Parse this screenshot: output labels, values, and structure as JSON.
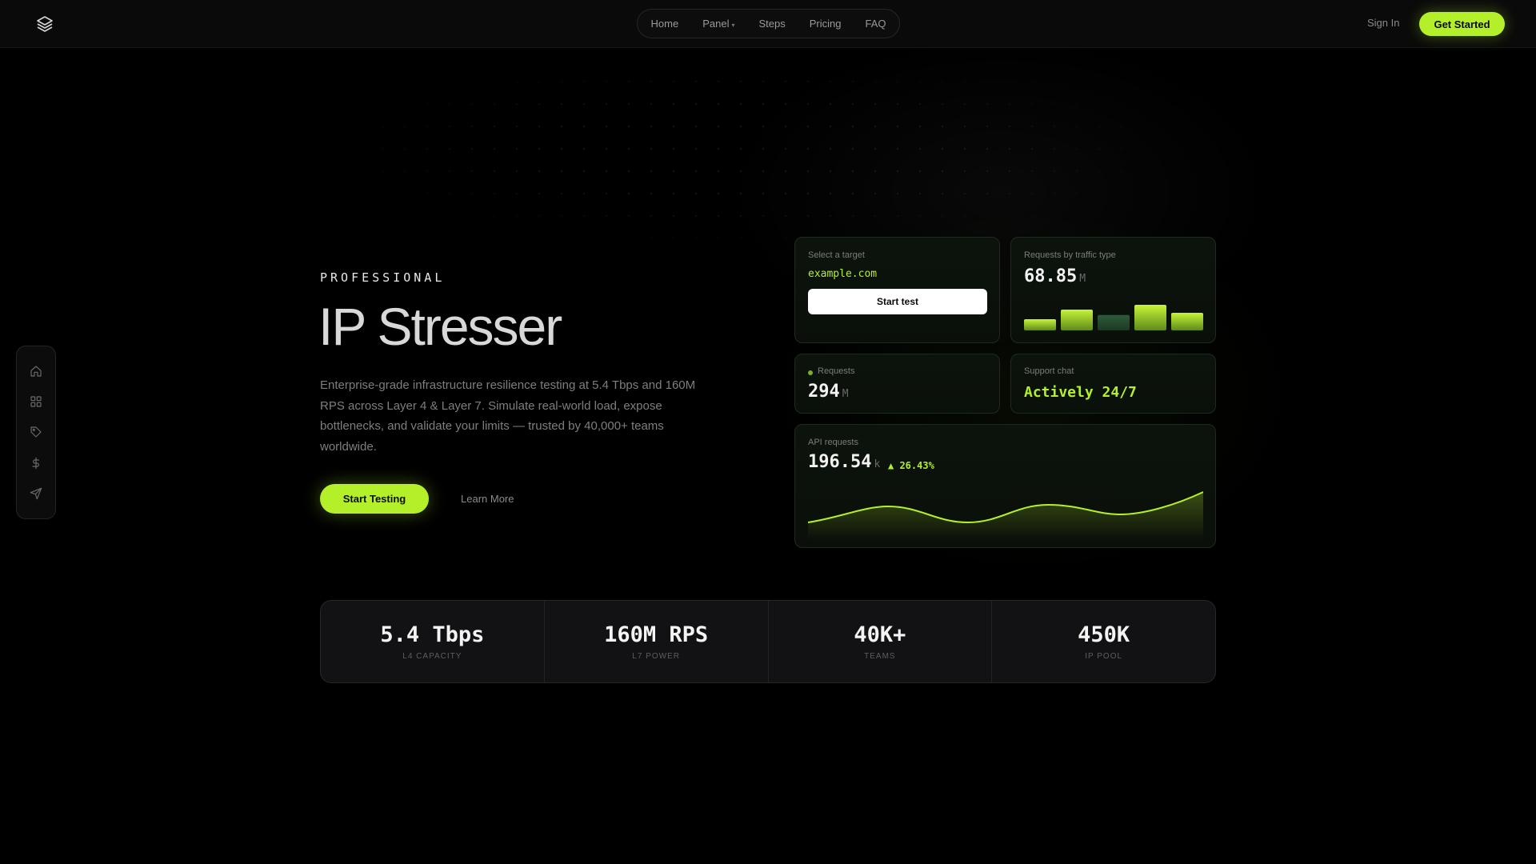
{
  "colors": {
    "accent": "#b4f02a",
    "background": "#000000",
    "card": "#0c130c"
  },
  "nav": {
    "items": [
      {
        "label": "Home"
      },
      {
        "label": "Panel",
        "has_dropdown": true
      },
      {
        "label": "Steps"
      },
      {
        "label": "Pricing"
      },
      {
        "label": "FAQ"
      }
    ],
    "sign_in": "Sign In",
    "get_started": "Get Started"
  },
  "siderail": {
    "icons": [
      "home-icon",
      "grid-icon",
      "tag-icon",
      "dollar-icon",
      "send-icon"
    ]
  },
  "hero": {
    "eyebrow": "PROFESSIONAL",
    "title": "IP Stresser",
    "description": "Enterprise-grade infrastructure resilience testing at 5.4 Tbps and 160M RPS across Layer 4 & Layer 7. Simulate real-world load, expose bottlenecks, and validate your limits — trusted by 40,000+ teams worldwide.",
    "primary_cta": "Start Testing",
    "secondary_cta": "Learn More"
  },
  "cards": {
    "target": {
      "label": "Select a target",
      "value": "example.com",
      "button": "Start test"
    },
    "traffic": {
      "label": "Requests by traffic type",
      "value": "68.85",
      "unit": "M",
      "bars": [
        0.35,
        0.65,
        0.48,
        0.8,
        0.55
      ]
    },
    "requests": {
      "label": "Requests",
      "value": "294",
      "unit": "M"
    },
    "support": {
      "label": "Support chat",
      "value": "Actively 24/7"
    },
    "api": {
      "label": "API requests",
      "value": "196.54",
      "unit": "k",
      "delta": "▲ 26.43%"
    }
  },
  "stats": [
    {
      "value": "5.4 Tbps",
      "label": "L4 CAPACITY"
    },
    {
      "value": "160M RPS",
      "label": "L7 POWER"
    },
    {
      "value": "40K+",
      "label": "TEAMS"
    },
    {
      "value": "450K",
      "label": "IP POOL"
    }
  ]
}
